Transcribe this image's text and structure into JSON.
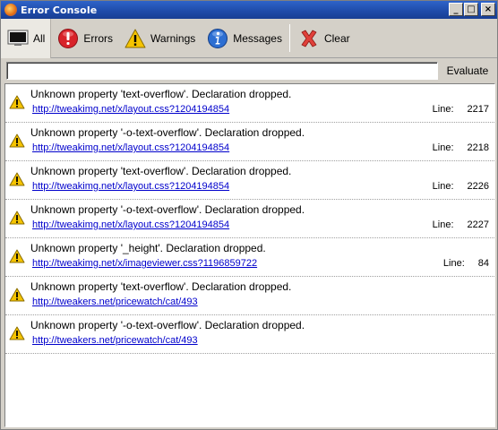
{
  "window": {
    "title": "Error Console"
  },
  "titlebar_buttons": {
    "minimize": "_",
    "maximize": "□",
    "close": "×"
  },
  "toolbar": {
    "all_label": "All",
    "errors_label": "Errors",
    "warnings_label": "Warnings",
    "messages_label": "Messages",
    "clear_label": "Clear",
    "selected": "All"
  },
  "evaluate": {
    "value": "",
    "button_label": "Evaluate"
  },
  "line_label": "Line:",
  "messages": [
    {
      "text": "Unknown property 'text-overflow'.  Declaration dropped.",
      "url": "http://tweakimg.net/x/layout.css?1204194854",
      "line": "2217",
      "icon": "warning-icon"
    },
    {
      "text": "Unknown property '-o-text-overflow'.  Declaration dropped.",
      "url": "http://tweakimg.net/x/layout.css?1204194854",
      "line": "2218",
      "icon": "warning-icon"
    },
    {
      "text": "Unknown property 'text-overflow'.  Declaration dropped.",
      "url": "http://tweakimg.net/x/layout.css?1204194854",
      "line": "2226",
      "icon": "warning-icon"
    },
    {
      "text": "Unknown property '-o-text-overflow'.  Declaration dropped.",
      "url": "http://tweakimg.net/x/layout.css?1204194854",
      "line": "2227",
      "icon": "warning-icon"
    },
    {
      "text": "Unknown property '_height'.  Declaration dropped.",
      "url": "http://tweakimg.net/x/imageviewer.css?1196859722",
      "line": "84",
      "icon": "warning-icon"
    },
    {
      "text": "Unknown property 'text-overflow'.  Declaration dropped.",
      "url": "http://tweakers.net/pricewatch/cat/493",
      "line": "",
      "icon": "warning-icon"
    },
    {
      "text": "Unknown property '-o-text-overflow'.  Declaration dropped.",
      "url": "http://tweakers.net/pricewatch/cat/493",
      "line": "",
      "icon": "warning-icon"
    }
  ],
  "colors": {
    "titlebar": "#1e4aa8",
    "link": "#0000cc",
    "warning": "#f5c400",
    "error": "#d8232a",
    "info": "#2d6fd2"
  }
}
